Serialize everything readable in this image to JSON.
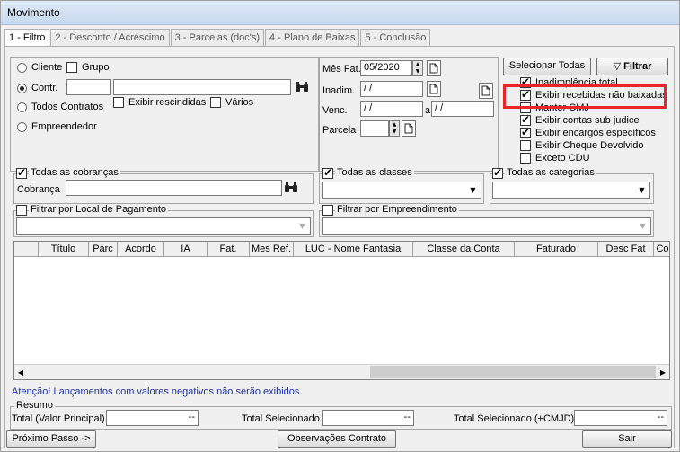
{
  "window": {
    "title": "Movimento"
  },
  "tabs": [
    {
      "label": "1 - Filtro"
    },
    {
      "label": "2 - Desconto / Acréscimo"
    },
    {
      "label": "3 - Parcelas (doc's)"
    },
    {
      "label": "4 - Plano de Baixas"
    },
    {
      "label": "5 - Conclusão"
    }
  ],
  "filter": {
    "radio_cliente": "Cliente",
    "check_grupo": "Grupo",
    "radio_contr": "Contr.",
    "check_rescindidas": "Exibir rescindidas",
    "check_varios": "Vários",
    "radio_todos": "Todos Contratos",
    "radio_empreendedor": "Empreendedor",
    "contr_value": "",
    "contr_name": ""
  },
  "dates": {
    "mes_fat_label": "Mês Fat.",
    "mes_fat_value": "05/2020",
    "inadim_label": "Inadim.",
    "inadim_value": " /  /",
    "venc_label": "Venc.",
    "venc_from": " /  /",
    "venc_sep": "a",
    "venc_to": " /  /",
    "parcela_label": "Parcela",
    "parcela_value": ""
  },
  "options": {
    "select_all": "Selecionar Todas",
    "filter_button": "Filtrar",
    "items": [
      {
        "label": "Inadimplência total",
        "checked": true
      },
      {
        "label": "Exibir recebidas não baixadas",
        "checked": true
      },
      {
        "label": "Manter CMJ",
        "checked": false
      },
      {
        "label": "Exibir contas sub judice",
        "checked": true
      },
      {
        "label": "Exibir encargos específicos",
        "checked": true
      },
      {
        "label": "Exibir Cheque Devolvido",
        "checked": false
      },
      {
        "label": "Exceto CDU",
        "checked": false
      }
    ]
  },
  "cobrancas": {
    "legend": "Todas as cobranças",
    "label": "Cobrança",
    "value": ""
  },
  "classes": {
    "legend": "Todas as classes"
  },
  "categorias": {
    "legend": "Todas as categorias"
  },
  "local_pagamento": {
    "legend": "Filtrar por Local de Pagamento"
  },
  "empreendimento": {
    "legend": "Filtrar por Empreendimento"
  },
  "grid": {
    "columns": [
      "Título",
      "Parc",
      "Acordo",
      "IA",
      "Fat.",
      "Mes Ref.",
      "LUC - Nome Fantasia",
      "Classe da Conta",
      "Faturado",
      "Desc Fat",
      "Co"
    ]
  },
  "warning": "Atenção! Lançamentos com valores negativos não serão exibidos.",
  "resumo": {
    "legend": "Resumo",
    "total_principal_label": "Total (Valor Principal)",
    "total_principal_value": "--",
    "total_sel_label": "Total Selecionado",
    "total_sel_value": "--",
    "total_cmjd_label": "Total Selecionado (+CMJD)",
    "total_cmjd_value": "--"
  },
  "footer": {
    "next": "Próximo Passo ->",
    "obs": "Observações Contrato",
    "exit": "Sair"
  }
}
